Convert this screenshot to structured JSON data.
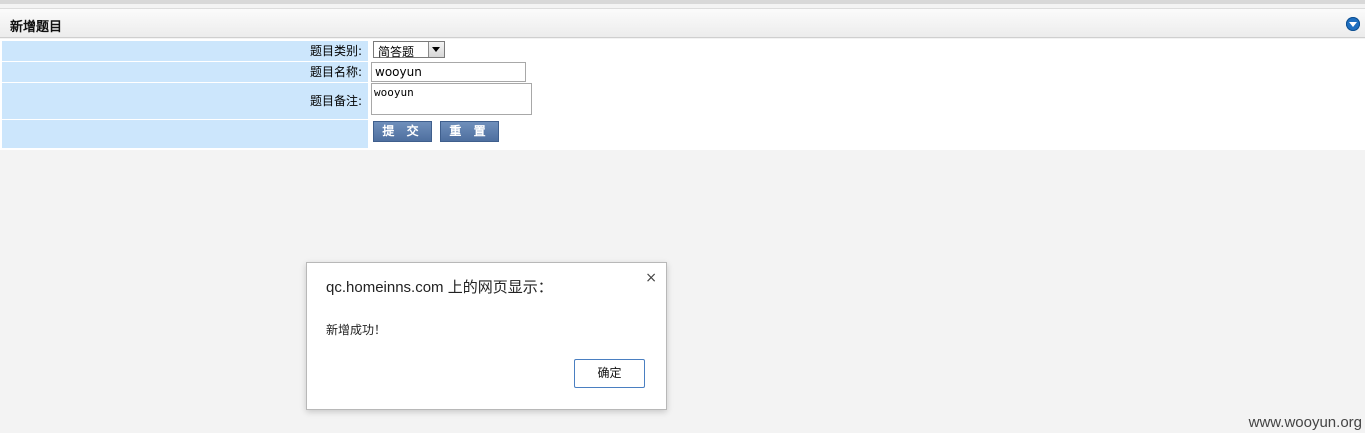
{
  "panel": {
    "title": "新增题目",
    "collapse_icon": "chevron-down-circle-icon"
  },
  "form": {
    "type_label": "题目类别:",
    "type_value": "简答题",
    "name_label": "题目名称:",
    "name_value": "wooyun",
    "remark_label": "题目备注:",
    "remark_value": "wooyun",
    "submit_label": "提 交",
    "reset_label": "重 置"
  },
  "dialog": {
    "title": "qc.homeinns.com 上的网页显示：",
    "close_label": "×",
    "message": "新增成功！",
    "ok_label": "确定"
  },
  "watermark": "www.wooyun.org",
  "colors": {
    "label_bg": "#cce6fc",
    "button_bg": "#5a7aaa",
    "dialog_button_border": "#4a7fc1"
  }
}
